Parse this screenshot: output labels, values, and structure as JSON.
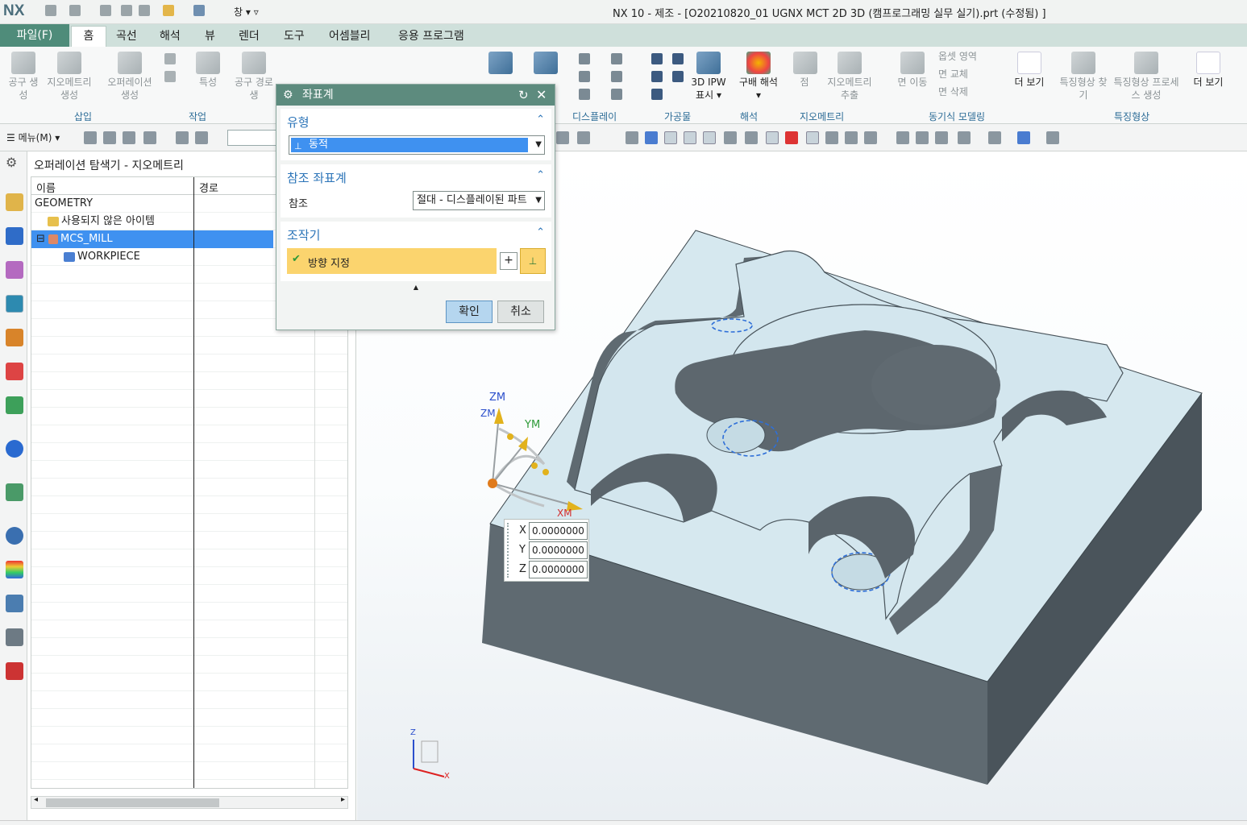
{
  "app": {
    "logo": "NX",
    "window_title": "NX 10 - 제조 - [O20210820_01 UGNX MCT 2D 3D (캠프로그래밍 실무 실기).prt (수정됨) ]",
    "window_menu": "창"
  },
  "ribbon_tabs": {
    "file": "파일(F)",
    "items": [
      "홈",
      "곡선",
      "해석",
      "뷰",
      "렌더",
      "도구",
      "어셈블리",
      "응용 프로그램"
    ]
  },
  "ribbon": {
    "groups": [
      "삽입",
      "작업",
      "디스플레이",
      "가공물",
      "해석",
      "지오메트리",
      "동기식 모델링",
      "특징형상"
    ],
    "buttons": {
      "tool_create": "공구 생성",
      "geometry_create": "지오메트리 생성",
      "operation_create": "오퍼레이션 생성",
      "property": "특성",
      "tool_path": "공구 경로 생",
      "ipw_display": "3D IPW 표시",
      "gradient_analysis": "구배 해석",
      "point": "점",
      "geometry_extract": "지오메트리 추출",
      "face_move": "면 이동",
      "offset_region": "옵셋 영역",
      "face_replace": "면 교체",
      "face_delete": "면 삭제",
      "more1": "더 보기",
      "feature_find": "특징형상 찾기",
      "feature_process": "특징형상 프로세스 생성",
      "more2": "더 보기"
    }
  },
  "toolbar": {
    "menu_label": "메뉴(M)"
  },
  "navigator": {
    "title": "오퍼레이션 탐색기 - 지오메트리",
    "columns": [
      "이름",
      "경로"
    ],
    "rows": [
      {
        "name": "GEOMETRY",
        "indent": 0,
        "selected": false
      },
      {
        "name": "사용되지 않은 아이템",
        "indent": 1,
        "selected": false
      },
      {
        "name": "MCS_MILL",
        "indent": 1,
        "selected": true
      },
      {
        "name": "WORKPIECE",
        "indent": 2,
        "selected": false
      }
    ]
  },
  "dialog": {
    "title": "좌표계",
    "type_section": {
      "header": "유형",
      "value": "동적"
    },
    "ref_section": {
      "header": "참조 좌표계",
      "label": "참조",
      "value": "절대 - 디스플레이된 파트"
    },
    "manip_section": {
      "header": "조작기",
      "item": "방향 지정"
    },
    "ok": "확인",
    "cancel": "취소"
  },
  "triad": {
    "zm": "ZM",
    "ym": "YM",
    "xm": "XM"
  },
  "coords": {
    "x_label": "X",
    "x": "0.0000000",
    "y_label": "Y",
    "y": "0.0000000",
    "z_label": "Z",
    "z": "0.0000000"
  },
  "view_triad": {
    "z": "Z",
    "x": "X"
  },
  "colors": {
    "file_tab": "#4f8c7a",
    "selection": "#3f91f0",
    "part_top": "#d6e8ef",
    "part_side": "#5a646b",
    "dialog_title": "#5d8b7e",
    "highlight": "#fbd46e"
  }
}
